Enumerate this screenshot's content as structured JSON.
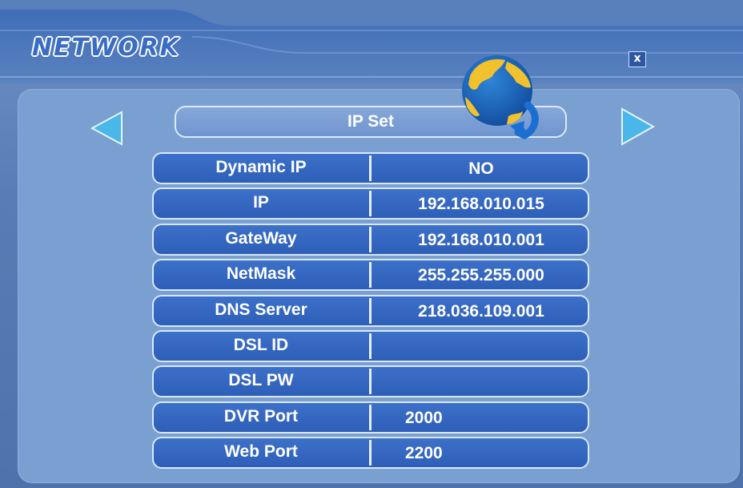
{
  "window": {
    "title": "NETWORK",
    "close_label": "x"
  },
  "page": {
    "tab_title": "IP Set",
    "prev_icon": "triangle-left-icon",
    "next_icon": "triangle-right-icon",
    "globe_icon": "globe-refresh-icon"
  },
  "settings": [
    {
      "label": "Dynamic IP",
      "value": "NO"
    },
    {
      "label": "IP",
      "value": "192.168.010.015"
    },
    {
      "label": "GateWay",
      "value": "192.168.010.001"
    },
    {
      "label": "NetMask",
      "value": "255.255.255.000"
    },
    {
      "label": "DNS Server",
      "value": "218.036.109.001"
    },
    {
      "label": "DSL ID",
      "value": ""
    },
    {
      "label": "DSL PW",
      "value": ""
    },
    {
      "label": "DVR Port",
      "value": "2000"
    },
    {
      "label": "Web Port",
      "value": "2200"
    }
  ],
  "colors": {
    "background": "#5c80b8",
    "panel": "#7aa0d2",
    "row": "#3566c0",
    "accent": "#47b3e8"
  }
}
